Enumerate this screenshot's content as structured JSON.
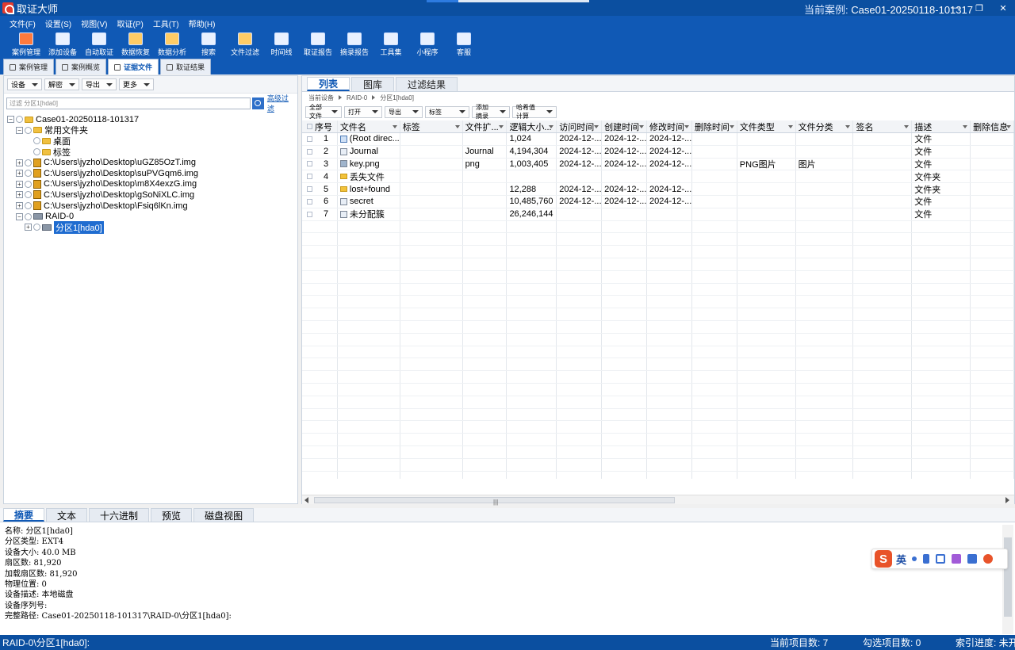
{
  "window": {
    "title": "取证大师",
    "case_label": "当前案例:",
    "case_value": "Case01-20250118-101317"
  },
  "menu": [
    "文件(F)",
    "设置(S)",
    "视图(V)",
    "取证(P)",
    "工具(T)",
    "帮助(H)"
  ],
  "toolbar": [
    {
      "label": "案例管理",
      "icon": "case-manage-icon"
    },
    {
      "label": "添加设备",
      "icon": "add-device-icon"
    },
    {
      "label": "自动取证",
      "icon": "auto-forensic-icon"
    },
    {
      "label": "数据恢复",
      "icon": "data-recovery-icon"
    },
    {
      "label": "数据分析",
      "icon": "data-analysis-icon"
    },
    {
      "label": "搜索",
      "icon": "search-icon"
    },
    {
      "label": "文件过滤",
      "icon": "file-filter-icon"
    },
    {
      "label": "时间线",
      "icon": "timeline-icon"
    },
    {
      "label": "取证报告",
      "icon": "report-icon"
    },
    {
      "label": "摘录报告",
      "icon": "excerpt-report-icon"
    },
    {
      "label": "工具集",
      "icon": "toolset-icon"
    },
    {
      "label": "小程序",
      "icon": "miniprogram-icon"
    },
    {
      "label": "客服",
      "icon": "support-icon"
    }
  ],
  "main_tabs": [
    {
      "label": "案例管理",
      "active": false
    },
    {
      "label": "案例概览",
      "active": false
    },
    {
      "label": "证据文件",
      "active": true
    },
    {
      "label": "取证结果",
      "active": false
    }
  ],
  "left_toolbar": [
    "设备",
    "解密",
    "导出",
    "更多"
  ],
  "filter": {
    "placeholder": "过滤 分区1[hda0]",
    "advanced": "高级过滤"
  },
  "tree": [
    {
      "label": "Case01-20250118-101317",
      "level": 0,
      "type": "folder",
      "exp": "−"
    },
    {
      "label": "常用文件夹",
      "level": 1,
      "type": "folder",
      "exp": "−"
    },
    {
      "label": "桌面",
      "level": 2,
      "type": "folder",
      "exp": ""
    },
    {
      "label": "标签",
      "level": 2,
      "type": "folder",
      "exp": ""
    },
    {
      "label": "C:\\Users\\jyzho\\Desktop\\uGZ85OzT.img",
      "level": 1,
      "type": "img",
      "exp": "+"
    },
    {
      "label": "C:\\Users\\jyzho\\Desktop\\suPVGqm6.img",
      "level": 1,
      "type": "img",
      "exp": "+"
    },
    {
      "label": "C:\\Users\\jyzho\\Desktop\\m8X4exzG.img",
      "level": 1,
      "type": "img",
      "exp": "+"
    },
    {
      "label": "C:\\Users\\jyzho\\Desktop\\gSoNiXLC.img",
      "level": 1,
      "type": "img",
      "exp": "+"
    },
    {
      "label": "C:\\Users\\jyzho\\Desktop\\Fsiq6lKn.img",
      "level": 1,
      "type": "img",
      "exp": "+"
    },
    {
      "label": "RAID-0",
      "level": 1,
      "type": "drive",
      "exp": "−"
    },
    {
      "label": "分区1[hda0]",
      "level": 2,
      "type": "drive",
      "exp": "+",
      "selected": true
    }
  ],
  "right_tabs": [
    {
      "label": "列表",
      "active": true
    },
    {
      "label": "图库",
      "active": false
    },
    {
      "label": "过滤结果",
      "active": false
    }
  ],
  "breadcrumb": [
    "当前设备",
    "RAID-0",
    "分区1[hda0]"
  ],
  "right_toolbar": [
    "全部文件",
    "打开",
    "导出",
    "标签",
    "添加摘录",
    "哈希值计算"
  ],
  "columns": [
    "序号",
    "文件名",
    "标签",
    "文件扩...",
    "逻辑大小...",
    "访问时间",
    "创建时间",
    "修改时间",
    "删除时间",
    "文件类型",
    "文件分类",
    "签名",
    "描述",
    "删除信息"
  ],
  "rows": [
    {
      "no": "1",
      "name": "(Root direc...",
      "icon": "root",
      "tag": "",
      "ext": "",
      "size": "1,024",
      "atime": "2024-12-...",
      "ctime": "2024-12-...",
      "mtime": "2024-12-...",
      "dtime": "",
      "ftype": "",
      "fcat": "",
      "sig": "",
      "desc": "文件",
      "del": ""
    },
    {
      "no": "2",
      "name": "Journal",
      "icon": "file",
      "tag": "",
      "ext": "Journal",
      "size": "4,194,304",
      "atime": "2024-12-...",
      "ctime": "2024-12-...",
      "mtime": "2024-12-...",
      "dtime": "",
      "ftype": "",
      "fcat": "",
      "sig": "",
      "desc": "文件",
      "del": ""
    },
    {
      "no": "3",
      "name": "key.png",
      "icon": "img",
      "tag": "",
      "ext": "png",
      "size": "1,003,405",
      "atime": "2024-12-...",
      "ctime": "2024-12-...",
      "mtime": "2024-12-...",
      "dtime": "",
      "ftype": "PNG图片",
      "fcat": "图片",
      "sig": "",
      "desc": "文件",
      "del": ""
    },
    {
      "no": "4",
      "name": "丢失文件",
      "icon": "folder",
      "tag": "",
      "ext": "",
      "size": "",
      "atime": "",
      "ctime": "",
      "mtime": "",
      "dtime": "",
      "ftype": "",
      "fcat": "",
      "sig": "",
      "desc": "文件夹",
      "del": ""
    },
    {
      "no": "5",
      "name": "lost+found",
      "icon": "folder",
      "tag": "",
      "ext": "",
      "size": "12,288",
      "atime": "2024-12-...",
      "ctime": "2024-12-...",
      "mtime": "2024-12-...",
      "dtime": "",
      "ftype": "",
      "fcat": "",
      "sig": "",
      "desc": "文件夹",
      "del": ""
    },
    {
      "no": "6",
      "name": "secret",
      "icon": "file",
      "tag": "",
      "ext": "",
      "size": "10,485,760",
      "atime": "2024-12-...",
      "ctime": "2024-12-...",
      "mtime": "2024-12-...",
      "dtime": "",
      "ftype": "",
      "fcat": "",
      "sig": "",
      "desc": "文件",
      "del": ""
    },
    {
      "no": "7",
      "name": "未分配簇",
      "icon": "file",
      "tag": "",
      "ext": "",
      "size": "26,246,144",
      "atime": "",
      "ctime": "",
      "mtime": "",
      "dtime": "",
      "ftype": "",
      "fcat": "",
      "sig": "",
      "desc": "文件",
      "del": ""
    }
  ],
  "bottom_tabs": [
    {
      "label": "摘要",
      "active": true
    },
    {
      "label": "文本",
      "active": false
    },
    {
      "label": "十六进制",
      "active": false
    },
    {
      "label": "预览",
      "active": false
    },
    {
      "label": "磁盘视图",
      "active": false
    }
  ],
  "summary": [
    "名称: 分区1[hda0]",
    "分区类型: EXT4",
    "设备大小: 40.0 MB",
    "扇区数: 81,920",
    "加载扇区数: 81,920",
    "物理位置: 0",
    "设备描述: 本地磁盘",
    "设备序列号:",
    "完整路径: Case01-20250118-101317\\RAID-0\\分区1[hda0]:"
  ],
  "ime": {
    "logo": "S",
    "mode": "英"
  },
  "status": {
    "path": "RAID-0\\分区1[hda0]:",
    "current_items": "当前项目数: 7",
    "checked_items": "勾选项目数: 0",
    "index_progress": "索引进度: 未开始"
  }
}
